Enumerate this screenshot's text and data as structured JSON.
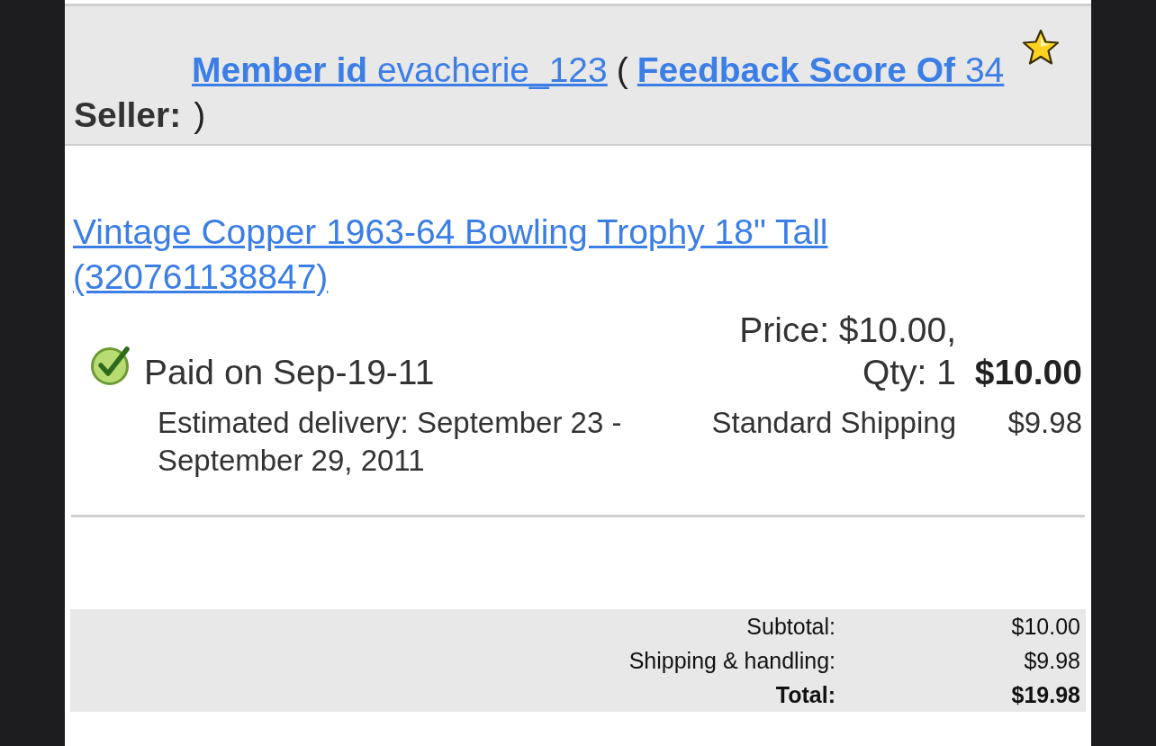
{
  "seller": {
    "label": "Seller:",
    "member_link": "**Member id** evacherie_123",
    "open_paren": "(",
    "feedback_link": "**Feedback Score Of** 34",
    "close_paren": ")"
  },
  "item": {
    "title": "Vintage Copper 1963-64 Bowling Trophy 18\" Tall (320761138847)",
    "paid": true,
    "status": "Paid on Sep-19-11",
    "delivery": "Estimated delivery: September 23 - September 29, 2011",
    "price_qty": "Price: $10.00, Qty: 1",
    "line_total": "$10.00",
    "shipping_method": "Standard Shipping",
    "shipping_cost": "$9.98"
  },
  "totals": [
    {
      "label": "Subtotal:",
      "value": "$10.00",
      "kind": "line"
    },
    {
      "label": "Shipping & handling:",
      "value": "$9.98",
      "kind": "line"
    },
    {
      "label": "Total:",
      "value": "$19.98",
      "kind": "total"
    }
  ]
}
